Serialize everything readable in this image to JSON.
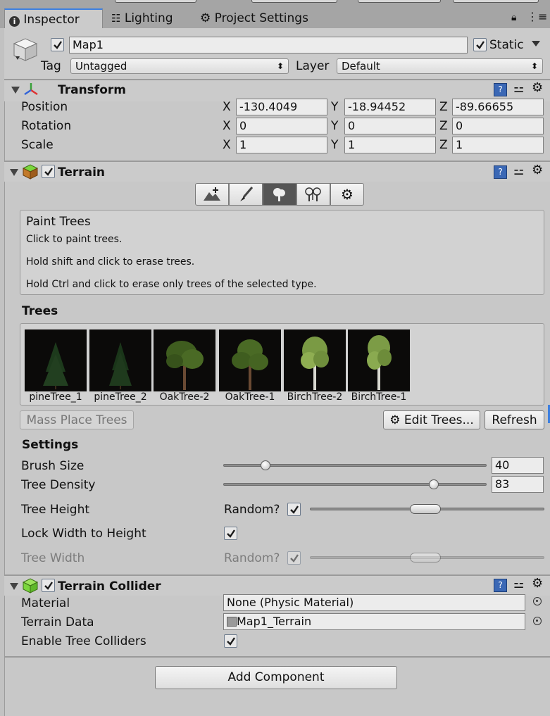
{
  "tabs": [
    {
      "label": "Inspector",
      "icon": "info-icon",
      "active": true
    },
    {
      "label": "Lighting",
      "icon": "lighting-icon",
      "active": false
    },
    {
      "label": "Project Settings",
      "icon": "gear-icon",
      "active": false
    }
  ],
  "object": {
    "name": "Map1",
    "active": true,
    "static_label": "Static",
    "static": true,
    "tag_label": "Tag",
    "tag_value": "Untagged",
    "layer_label": "Layer",
    "layer_value": "Default"
  },
  "transform": {
    "title": "Transform",
    "rows": [
      {
        "label": "Position",
        "x": "-130.4049",
        "y": "-18.94452",
        "z": "-89.66655"
      },
      {
        "label": "Rotation",
        "x": "0",
        "y": "0",
        "z": "0"
      },
      {
        "label": "Scale",
        "x": "1",
        "y": "1",
        "z": "1"
      }
    ],
    "axes": [
      "X",
      "Y",
      "Z"
    ]
  },
  "terrain": {
    "title": "Terrain",
    "enabled": true,
    "tools": [
      "raise-lower-icon",
      "paint-brush-icon",
      "paint-trees-icon",
      "paint-details-icon",
      "terrain-settings-icon"
    ],
    "selected_tool": 2,
    "help": {
      "title": "Paint Trees",
      "lines": [
        "Click to paint trees.",
        "Hold shift and click to erase trees.",
        "Hold Ctrl and click to erase only trees of the selected type."
      ]
    },
    "trees_header": "Trees",
    "trees": [
      "pineTree_1",
      "pineTree_2",
      "OakTree-2",
      "OakTree-1",
      "BirchTree-2",
      "BirchTree-1"
    ],
    "mass_place": "Mass Place Trees",
    "edit_trees": "Edit Trees...",
    "refresh": "Refresh",
    "settings_header": "Settings",
    "brush_size": {
      "label": "Brush Size",
      "value": "40",
      "fraction": 0.16
    },
    "tree_density": {
      "label": "Tree Density",
      "value": "83",
      "fraction": 0.8
    },
    "tree_height": {
      "label": "Tree Height",
      "random_label": "Random?",
      "random": true
    },
    "lock_width": {
      "label": "Lock Width to Height",
      "checked": true
    },
    "tree_width": {
      "label": "Tree Width",
      "random_label": "Random?",
      "random": true
    }
  },
  "collider": {
    "title": "Terrain Collider",
    "enabled": true,
    "material_label": "Material",
    "material_value": "None (Physic Material)",
    "data_label": "Terrain Data",
    "data_value": "Map1_Terrain",
    "trees_label": "Enable Tree Colliders",
    "trees_checked": true
  },
  "add_component": "Add Component"
}
